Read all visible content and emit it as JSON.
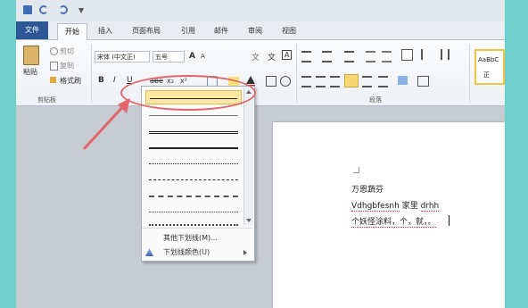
{
  "tabs": {
    "file": "文件",
    "home": "开始",
    "insert": "插入",
    "layout": "页面布局",
    "references": "引用",
    "mailings": "邮件",
    "review": "审阅",
    "view": "视图"
  },
  "clipboard": {
    "paste": "粘贴",
    "cut": "剪切",
    "copy": "复制",
    "format_painter": "格式刷",
    "group_label": "剪贴板"
  },
  "font": {
    "name": "宋体 (中文正)",
    "size": "五号",
    "bold": "B",
    "italic": "I",
    "underline": "U",
    "strike": "abe",
    "subscript": "x₂",
    "superscript": "x²",
    "grow": "A",
    "shrink": "A",
    "wen": "文",
    "phonetic": "文",
    "charborder": "A"
  },
  "paragraph": {
    "group_label": "段落"
  },
  "styles": {
    "preview": "AaBbC",
    "label": "正"
  },
  "document": {
    "line1": "万恩蔬芬",
    "line2_a": "Vdhgbfesnh",
    "line2_b": "家里",
    "line2_c": "drhh",
    "line3": "个妖怪涂料，个，就，。"
  },
  "dropdown": {
    "more_underlines": "其他下划线(M)...",
    "underline_color": "下划线颜色(U)"
  },
  "colors": {
    "accent_file": "#2b5797",
    "callout": "#e3646a",
    "highlight": "#ffe27a",
    "background": "#6fcfc9"
  },
  "icons": [
    "save-icon",
    "undo-icon",
    "redo-icon",
    "paste-icon",
    "cut-icon",
    "copy-icon",
    "format-painter-icon",
    "underline-color-icon",
    "arrow-icon"
  ]
}
